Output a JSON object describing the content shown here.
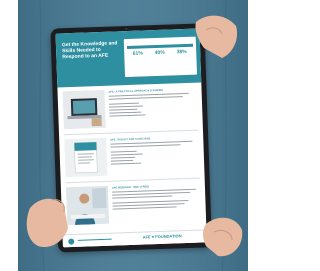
{
  "hero": {
    "title": "Get the Knowledge and Skills Needed to Respond to an AFE"
  },
  "stats": {
    "heading": "",
    "items": [
      {
        "num": "61%",
        "label": ""
      },
      {
        "num": "40%",
        "label": ""
      },
      {
        "num": "38%",
        "label": ""
      }
    ]
  },
  "sections": [
    {
      "title": "AFE: A PRACTICAL APPROACH (COURSE)"
    },
    {
      "title": "AFE TOOLKIT FOR CLINICIANS"
    },
    {
      "title": "AFE WEBINAR: 'OBS' (FREE)"
    }
  ],
  "footer": {
    "logo": "AFE ♥ FOUNDATION"
  },
  "colors": {
    "brand": "#2e8fa0",
    "background": "#ffffff",
    "shirt": "#4a7a93"
  }
}
